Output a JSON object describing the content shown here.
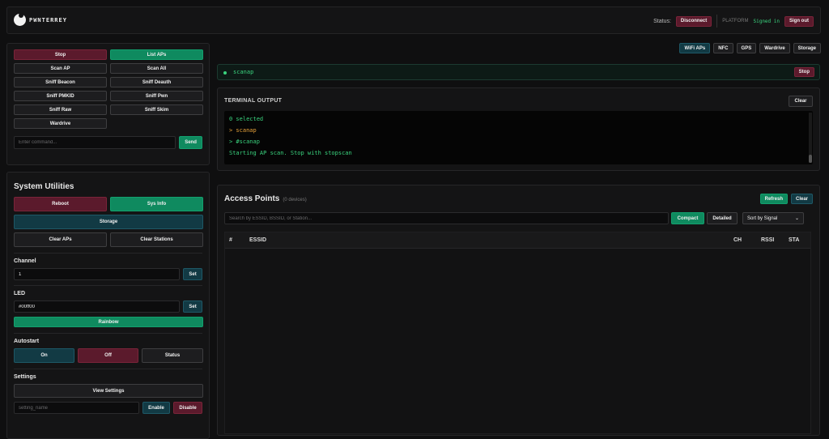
{
  "header": {
    "brand": "PWNTERREY",
    "status_label": "Status:",
    "disconnect": "Disconnect",
    "platform_label": "PLATFORM",
    "signed_in": "Signed in",
    "sign_out": "Sign out"
  },
  "wifi_panel": {
    "stop": "Stop",
    "list_aps": "List APs",
    "buttons": [
      "Scan AP",
      "Scan All",
      "Sniff Beacon",
      "Sniff Deauth",
      "Sniff PMKID",
      "Sniff Pwn",
      "Sniff Raw",
      "Sniff Skim",
      "Wardrive"
    ],
    "command_placeholder": "Enter command...",
    "send": "Send"
  },
  "utilities": {
    "title": "System Utilities",
    "reboot": "Reboot",
    "sys_info": "Sys Info",
    "storage": "Storage",
    "clear_aps": "Clear APs",
    "clear_stations": "Clear Stations",
    "channel_label": "Channel",
    "channel_value": "1",
    "set": "Set",
    "led_label": "LED",
    "led_value": "#00ff00",
    "rainbow": "Rainbow",
    "autostart_label": "Autostart",
    "on": "On",
    "off": "Off",
    "status": "Status",
    "settings_label": "Settings",
    "view_settings": "View Settings",
    "setting_placeholder": "setting_name",
    "enable": "Enable",
    "disable": "Disable"
  },
  "tabs": [
    "WiFi APs",
    "NFC",
    "GPS",
    "Wardrive",
    "Storage"
  ],
  "command_bar": {
    "command": "scanap",
    "stop": "Stop"
  },
  "terminal": {
    "title": "TERMINAL OUTPUT",
    "clear": "Clear",
    "lines": [
      "0 selected",
      "> scanap",
      "> #scanap",
      "Starting AP scan. Stop with stopscan"
    ]
  },
  "access_points": {
    "title": "Access Points",
    "count": "(0 devices)",
    "refresh": "Refresh",
    "clear": "Clear",
    "search_placeholder": "Search by ESSID, BSSID, or Station...",
    "compact": "Compact",
    "detailed": "Detailed",
    "sort": "Sort by Signal",
    "columns": [
      "#",
      "ESSID",
      "CH",
      "RSSI",
      "STA"
    ]
  },
  "colors": {
    "accent_green": "#0f8a5f",
    "accent_red": "#5b1a2c",
    "accent_teal": "#123a44",
    "terminal_green": "#3ad37e",
    "terminal_orange": "#e8a23a"
  }
}
